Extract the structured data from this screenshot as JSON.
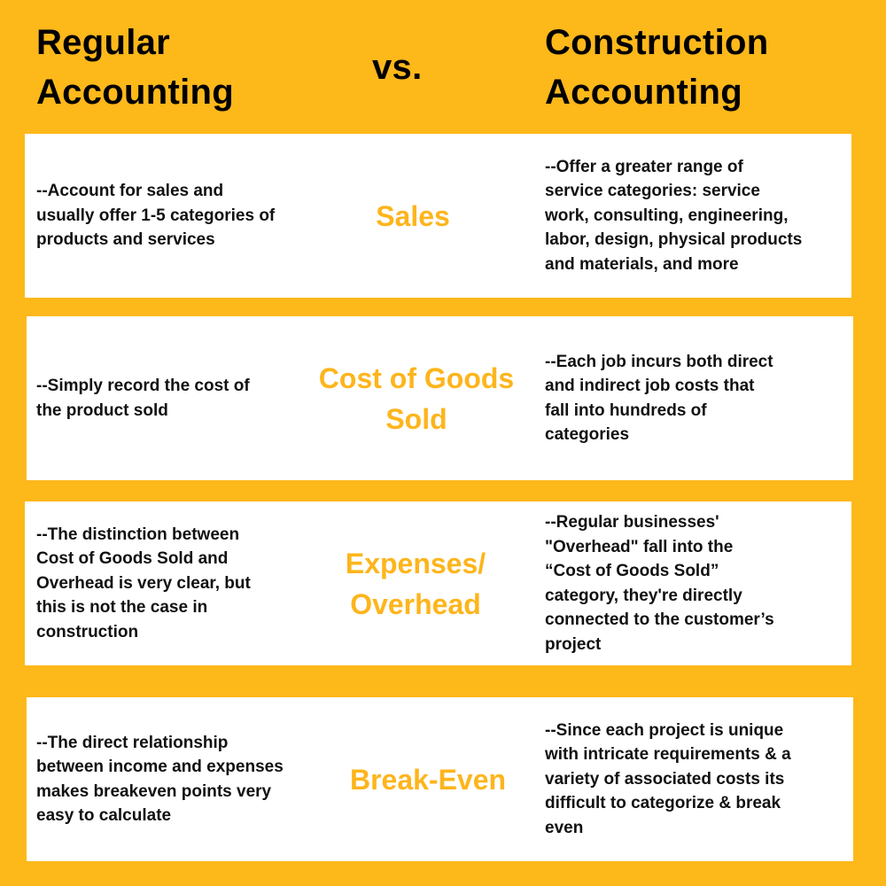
{
  "header": {
    "left_title": "Regular\nAccounting",
    "vs": "vs.",
    "right_title": "Construction\nAccounting"
  },
  "colors": {
    "background": "#FDB81A",
    "accent": "#FDB51C",
    "text": "#111111",
    "panel": "#FFFFFF"
  },
  "rows": [
    {
      "label": "Sales",
      "regular": "--Account for sales and\nusually offer 1-5 categories of\n products and services",
      "construction": "--Offer a greater range of\nservice categories: service\nwork, consulting, engineering,\nlabor, design, physical products\nand materials, and more"
    },
    {
      "label": "Cost of Goods\nSold",
      "regular": "--Simply record the cost of\nthe product sold",
      "construction": "--Each job incurs both direct\nand indirect job costs that\nfall into hundreds of\ncategories"
    },
    {
      "label": "Expenses/\nOverhead",
      "regular": "--The distinction between\nCost of Goods Sold and\nOverhead is very clear, but\nthis is not the case in\nconstruction",
      "construction": "--Regular businesses'\n\"Overhead\" fall into the\n“Cost of Goods Sold”\ncategory, they're directly\nconnected to the customer’s\nproject"
    },
    {
      "label": "Break-Even",
      "regular": "--The direct relationship\nbetween income and expenses\nmakes breakeven points very\neasy to calculate",
      "construction": "--Since each project is unique\nwith intricate requirements & a\nvariety of associated costs its\ndifficult to categorize & break\neven"
    }
  ]
}
